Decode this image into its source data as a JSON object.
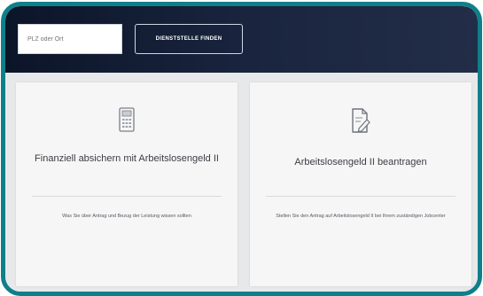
{
  "header": {
    "search_placeholder": "PLZ oder Ort",
    "find_button_label": "DIENSTSTELLE FINDEN"
  },
  "cards": [
    {
      "icon": "calculator-icon",
      "title": "Finanziell absichern mit Arbeitslosengeld II",
      "description": "Was Sie über Antrag und Bezug der Leistung wissen sollten"
    },
    {
      "icon": "edit-document-icon",
      "title": "Arbeitslosengeld II beantragen",
      "description": "Stellen Sie den Antrag auf Arbeitslosengeld II bei Ihrem zuständigen Jobcenter"
    }
  ],
  "colors": {
    "frame_border": "#0f7f8a",
    "header_bg": "#0c1528",
    "content_bg": "#e7e8ea",
    "card_bg": "#f6f6f7"
  }
}
